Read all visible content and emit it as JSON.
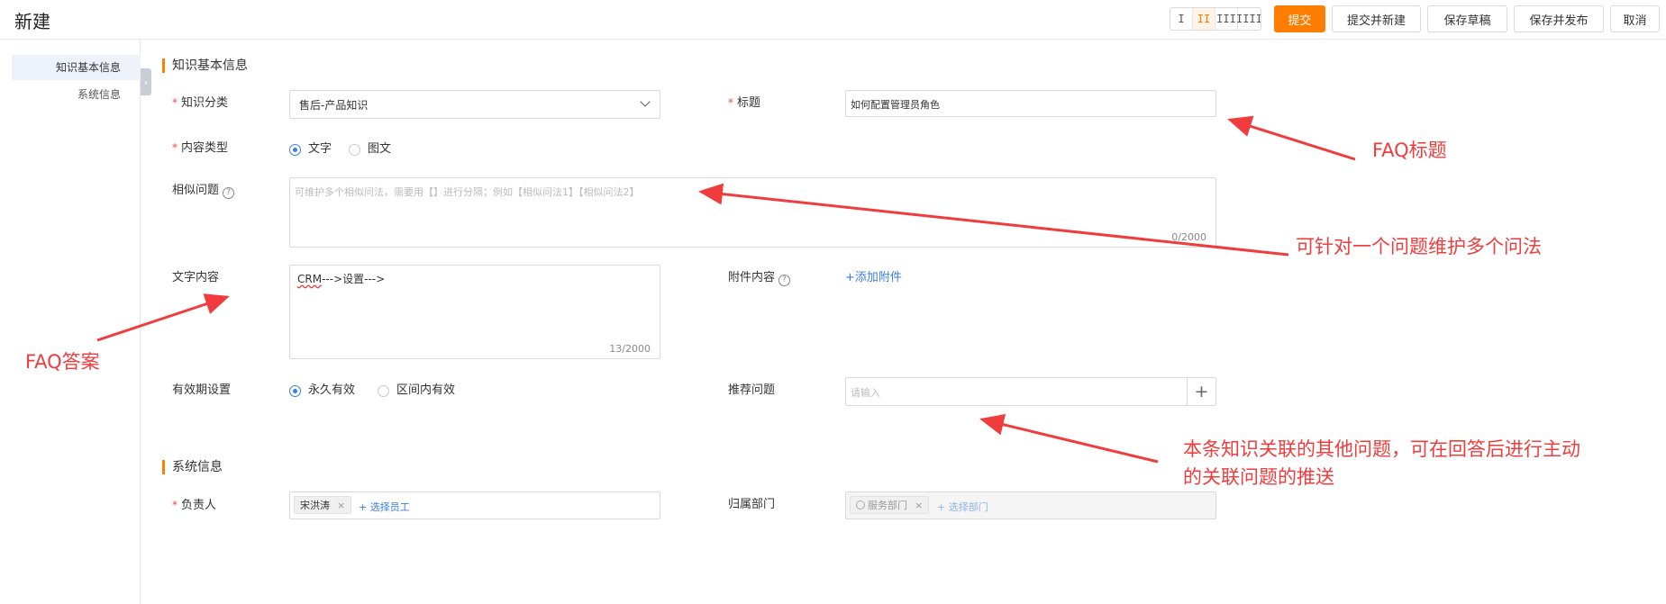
{
  "header": {
    "title": "新建",
    "column_options": [
      "I",
      "II",
      "III",
      "IIII"
    ],
    "column_selected": "II",
    "buttons": {
      "submit": "提交",
      "submit_new": "提交并新建",
      "save_draft": "保存草稿",
      "save_publish": "保存并发布",
      "cancel": "取消"
    }
  },
  "nav": {
    "items": [
      {
        "label": "知识基本信息",
        "active": true
      },
      {
        "label": "系统信息",
        "active": false
      }
    ]
  },
  "basic": {
    "section_title": "知识基本信息",
    "category": {
      "label": "知识分类",
      "value": "售后-产品知识"
    },
    "title": {
      "label": "标题",
      "value": "如何配置管理员角色"
    },
    "content_type": {
      "label": "内容类型",
      "options": [
        "文字",
        "图文"
      ],
      "selected": "文字"
    },
    "similar": {
      "label": "相似问题",
      "placeholder": "可维护多个相似问法，需要用【】进行分隔；例如【相似问法1】【相似问法2】",
      "counter": "0/2000"
    },
    "text_content": {
      "label": "文字内容",
      "value_prefix": "CRM",
      "value_rest": "--->设置--->",
      "counter": "13/2000"
    },
    "attachment": {
      "label": "附件内容",
      "link": "+添加附件"
    },
    "validity": {
      "label": "有效期设置",
      "options": [
        "永久有效",
        "区间内有效"
      ],
      "selected": "永久有效"
    },
    "recommend": {
      "label": "推荐问题",
      "placeholder": "请输入",
      "add": "+"
    }
  },
  "system": {
    "section_title": "系统信息",
    "owner": {
      "label": "负责人",
      "tag": "宋洪涛",
      "link": "+ 选择员工"
    },
    "dept": {
      "label": "归属部门",
      "tag": "服务部门",
      "link": "+ 选择部门"
    }
  },
  "annotations": {
    "faq_title": "FAQ标题",
    "multi_ask": "可针对一个问题维护多个问法",
    "faq_answer": "FAQ答案",
    "related_line1": "本条知识关联的其他问题，可在回答后进行主动",
    "related_line2": "的关联问题的推送"
  },
  "colors": {
    "accent": "#ff7d00",
    "link": "#3a7ee4",
    "required": "#f04848",
    "annotation": "#f03c3c"
  }
}
